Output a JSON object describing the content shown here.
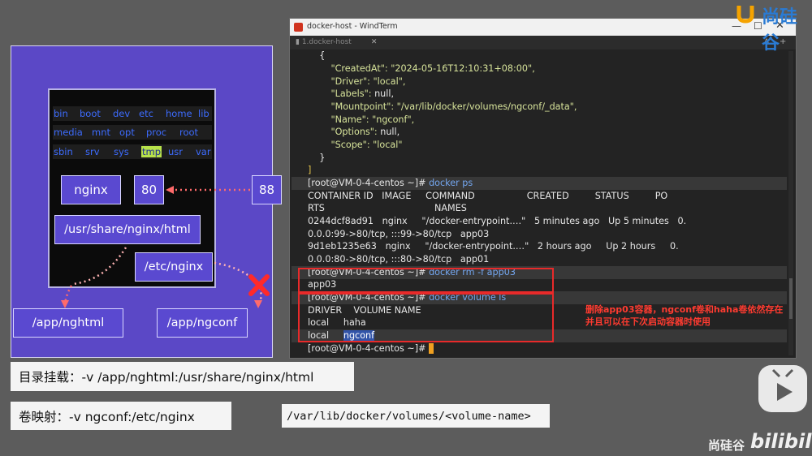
{
  "diagram": {
    "root_rows": [
      [
        "bin",
        "boot",
        "dev",
        "etc",
        "home",
        "lib"
      ],
      [
        "media",
        "mnt",
        "opt",
        "proc",
        "root"
      ],
      [
        "sbin",
        "srv",
        "sys",
        "tmp",
        "usr",
        "var"
      ]
    ],
    "nginx": "nginx",
    "container_port": "80",
    "host_port": "88",
    "html_path": "/usr/share/nginx/html",
    "etc_path": "/etc/nginx",
    "host_html": "/app/nghtml",
    "host_conf": "/app/ngconf"
  },
  "captions": {
    "bind_mount": "目录挂载：-v /app/nghtml:/usr/share/nginx/html",
    "volume_mount": "卷映射：-v ngconf:/etc/nginx",
    "volume_path": "/var/lib/docker/volumes/<volume-name>"
  },
  "window": {
    "title": "docker-host - WindTerm",
    "tab": "1.docker-host"
  },
  "terminal": {
    "brace_open": "{",
    "created_key": "\"CreatedAt\": ",
    "created_val": "\"2024-05-16T12:10:31+08:00\",",
    "driver_key": "\"Driver\": ",
    "driver_val": "\"local\",",
    "labels_key": "\"Labels\": ",
    "labels_val": "null,",
    "mount_key": "\"Mountpoint\": ",
    "mount_val": "\"/var/lib/docker/volumes/ngconf/_data\",",
    "name_key": "\"Name\": ",
    "name_val": "\"ngconf\",",
    "options_key": "\"Options\": ",
    "options_val": "null,",
    "scope_key": "\"Scope\": ",
    "scope_val": "\"local\"",
    "brace_close": "}",
    "bracket_close": "]",
    "prompt": "[root@VM-0-4-centos ~]#",
    "cmd_ps": "docker ps",
    "ps_header": "CONTAINER ID   IMAGE     COMMAND                  CREATED         STATUS         PO",
    "ps_header2": "RTS                                      NAMES",
    "row1": "0244dcf8ad91   nginx     \"/docker-entrypoint.…\"   5 minutes ago   Up 5 minutes   0.",
    "row1b": "0.0.0:99->80/tcp, :::99->80/tcp   app03",
    "row2": "9d1eb1235e63   nginx     \"/docker-entrypoint.…\"   2 hours ago     Up 2 hours     0.",
    "row2b": "0.0.0:80->80/tcp, :::80->80/tcp   app01",
    "cmd_rm": "docker rm -f app03",
    "rm_out": "app03",
    "cmd_vol": "docker volume ls",
    "vol_header": "DRIVER    VOLUME NAME",
    "vol_row1": "local     haha",
    "vol_row2_driver": "local     ",
    "vol_row2_name": "ngconf"
  },
  "annotation": {
    "line1": "删除app03容器，ngconf卷和haha卷依然存在",
    "line2": "并且可以在下次启动容器时使用"
  },
  "watermark": {
    "brand": "尚硅谷",
    "site": "bilibili"
  }
}
